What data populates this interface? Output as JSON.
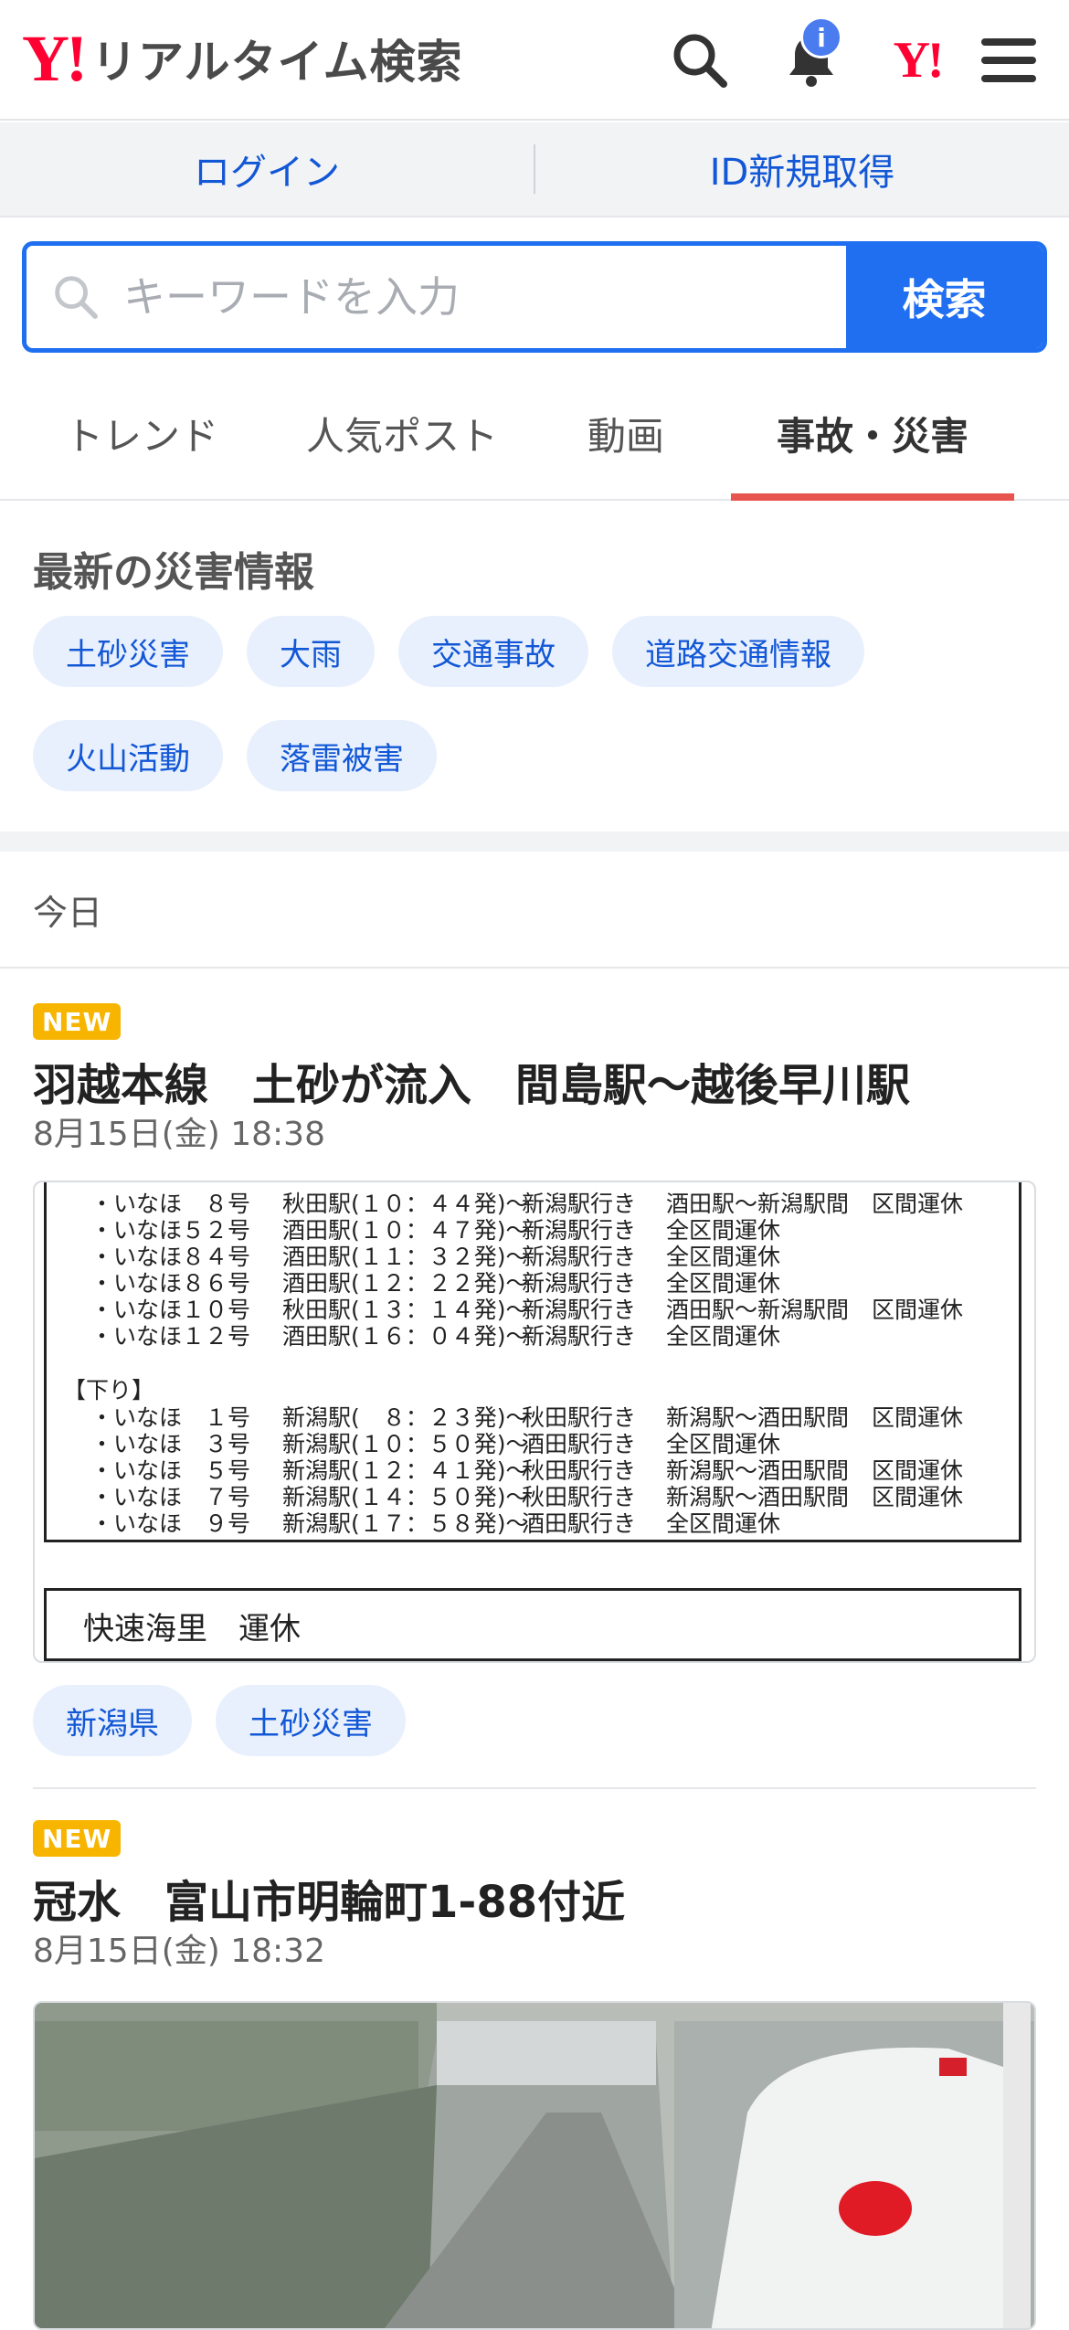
{
  "header": {
    "logo_mark": "Y!",
    "logo_text": "リアルタイム検索",
    "notification_badge": "i",
    "yahoo_mark": "Y!"
  },
  "auth": {
    "login": "ログイン",
    "signup": "ID新規取得"
  },
  "search": {
    "placeholder": "キーワードを入力",
    "button": "検索"
  },
  "tabs": [
    {
      "label": "トレンド",
      "active": false
    },
    {
      "label": "人気ポスト",
      "active": false
    },
    {
      "label": "動画",
      "active": false
    },
    {
      "label": "事故・災害",
      "active": true
    }
  ],
  "disaster_info": {
    "title": "最新の災害情報",
    "chips": [
      "土砂災害",
      "大雨",
      "交通事故",
      "道路交通情報",
      "火山活動",
      "落雷被害"
    ]
  },
  "section_date": "今日",
  "posts": [
    {
      "badge": "NEW",
      "title": "羽越本線　土砂が流入　間島駅～越後早川駅",
      "time": "8月15日(金) 18:38",
      "timetable": {
        "up_rows": [
          [
            "・いなほ　８号",
            "秋田駅(１０：４４発)～",
            "新潟駅行き",
            "酒田駅～新潟駅間　区間運休"
          ],
          [
            "・いなほ５２号",
            "酒田駅(１０：４７発)～",
            "新潟駅行き",
            "全区間運休"
          ],
          [
            "・いなほ８４号",
            "酒田駅(１１：３２発)～",
            "新潟駅行き",
            "全区間運休"
          ],
          [
            "・いなほ８６号",
            "酒田駅(１２：２２発)～",
            "新潟駅行き",
            "全区間運休"
          ],
          [
            "・いなほ１０号",
            "秋田駅(１３：１４発)～",
            "新潟駅行き",
            "酒田駅～新潟駅間　区間運休"
          ],
          [
            "・いなほ１２号",
            "酒田駅(１６：０４発)～",
            "新潟駅行き",
            "全区間運休"
          ]
        ],
        "down_heading": "【下り】",
        "down_rows": [
          [
            "・いなほ　１号",
            "新潟駅(　８：２３発)～",
            "秋田駅行き",
            "新潟駅～酒田駅間　区間運休"
          ],
          [
            "・いなほ　３号",
            "新潟駅(１０：５０発)～",
            "酒田駅行き",
            "全区間運休"
          ],
          [
            "・いなほ　５号",
            "新潟駅(１２：４１発)～",
            "秋田駅行き",
            "新潟駅～酒田駅間　区間運休"
          ],
          [
            "・いなほ　７号",
            "新潟駅(１４：５０発)～",
            "秋田駅行き",
            "新潟駅～酒田駅間　区間運休"
          ],
          [
            "・いなほ　９号",
            "新潟駅(１７：５８発)～",
            "酒田駅行き",
            "全区間運休"
          ]
        ],
        "box2_text": "快速海里　運休"
      },
      "tags": [
        "新潟県",
        "土砂災害"
      ]
    },
    {
      "badge": "NEW",
      "title": "冠水　富山市明輪町1-88付近",
      "time": "8月15日(金) 18:32"
    }
  ],
  "colors": {
    "brand_red": "#ff0033",
    "link_blue": "#1257d6",
    "search_blue": "#1f6ff0",
    "tab_indicator": "#e8554e",
    "new_badge": "#f7b500",
    "chip_bg": "#e8f0fd"
  }
}
